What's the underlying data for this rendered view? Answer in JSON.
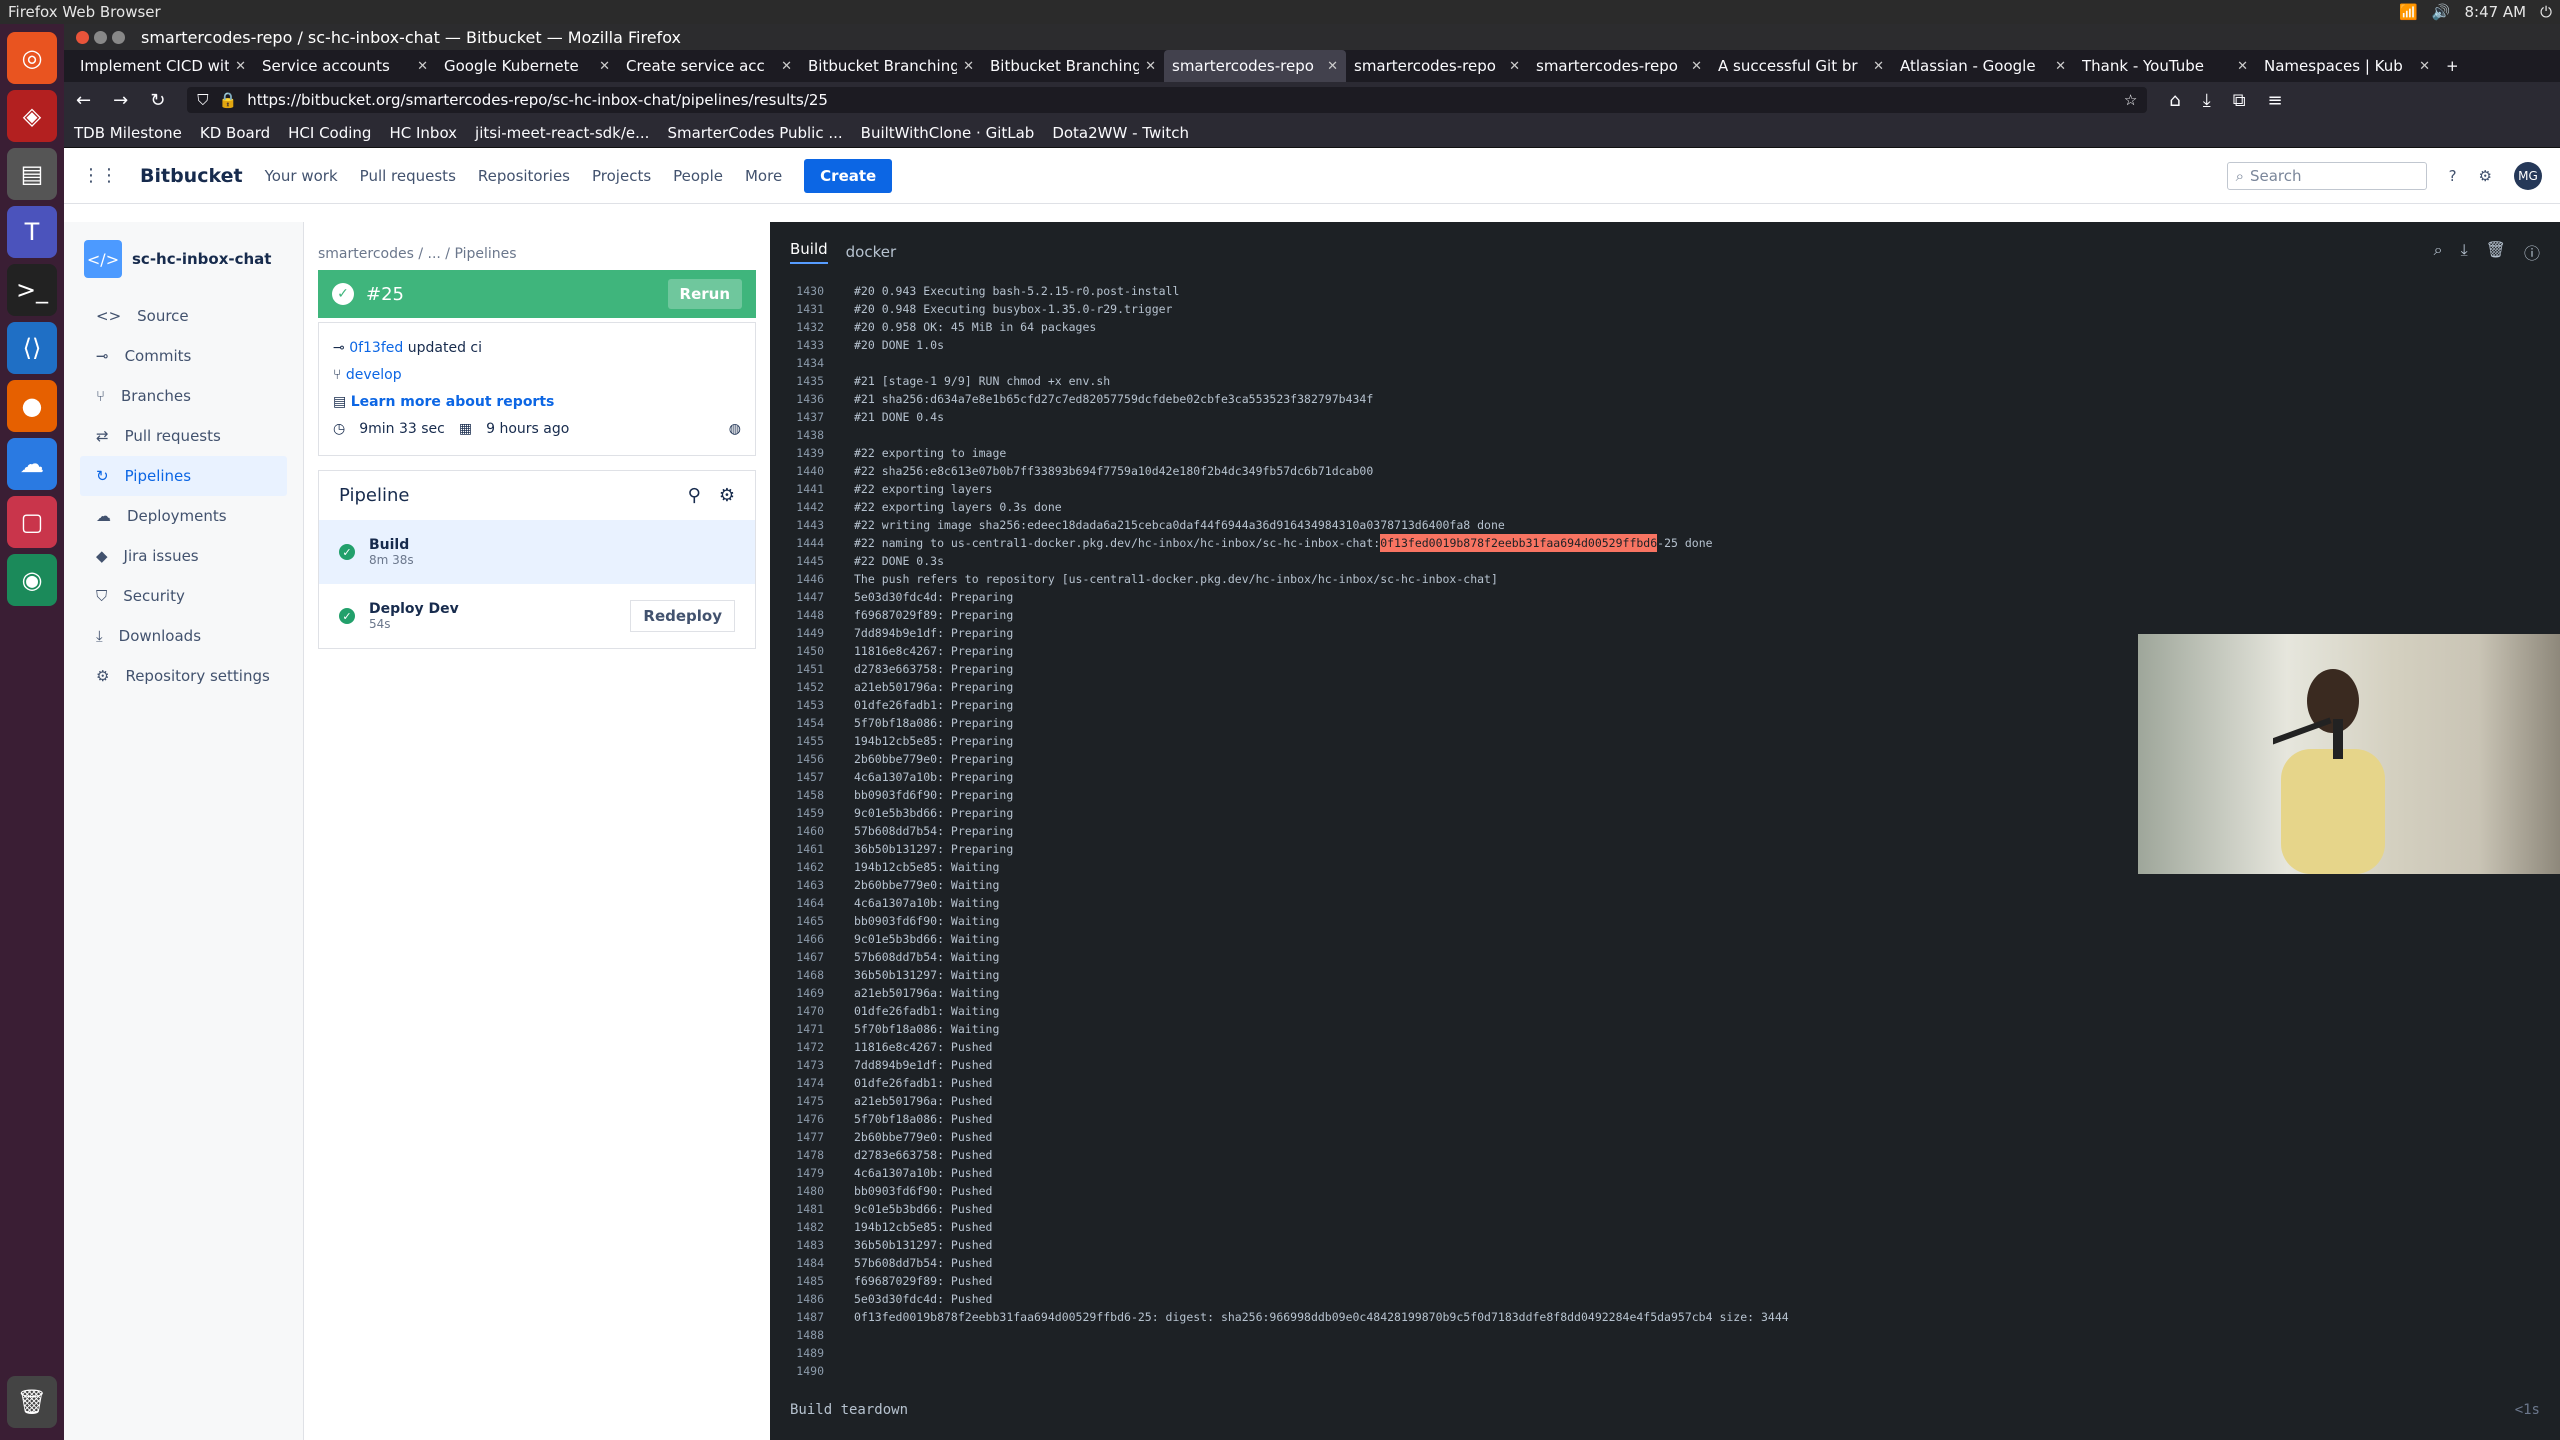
{
  "os": {
    "app_name": "Firefox Web Browser",
    "time": "8:47 AM"
  },
  "window": {
    "title": "smartercodes-repo / sc-hc-inbox-chat — Bitbucket — Mozilla Firefox"
  },
  "tabs": [
    {
      "label": "Implement CICD with"
    },
    {
      "label": "Service accounts"
    },
    {
      "label": "Google Kubernete"
    },
    {
      "label": "Create service acc"
    },
    {
      "label": "Bitbucket Branching"
    },
    {
      "label": "Bitbucket Branching"
    },
    {
      "label": "smartercodes-repo",
      "active": true
    },
    {
      "label": "smartercodes-repo"
    },
    {
      "label": "smartercodes-repo"
    },
    {
      "label": "A successful Git br"
    },
    {
      "label": "Atlassian - Google"
    },
    {
      "label": "Thank - YouTube"
    },
    {
      "label": "Namespaces | Kub"
    }
  ],
  "url": "https://bitbucket.org/smartercodes-repo/sc-hc-inbox-chat/pipelines/results/25",
  "bookmarks": [
    "TDB Milestone",
    "KD Board",
    "HCI Coding",
    "HC Inbox",
    "jitsi-meet-react-sdk/e...",
    "SmarterCodes Public ...",
    "BuiltWithClone · GitLab",
    "Dota2WW - Twitch"
  ],
  "bb": {
    "logo": "Bitbucket",
    "nav": [
      "Your work",
      "Pull requests",
      "Repositories",
      "Projects",
      "People",
      "More"
    ],
    "create": "Create",
    "search_placeholder": "Search",
    "avatar": "MG"
  },
  "sidebar": {
    "repo": "sc-hc-inbox-chat",
    "items": [
      "Source",
      "Commits",
      "Branches",
      "Pull requests",
      "Pipelines",
      "Deployments",
      "Jira issues",
      "Security",
      "Downloads",
      "Repository settings"
    ]
  },
  "pipeline": {
    "breadcrumb": "smartercodes  /  ...  /  Pipelines",
    "number": "#25",
    "rerun": "Rerun",
    "commit": "0f13fed",
    "commit_msg": "updated ci",
    "branch": "develop",
    "reports": "Learn more about reports",
    "duration": "9min 33 sec",
    "ago": "9 hours ago",
    "heading": "Pipeline",
    "steps": [
      {
        "name": "Build",
        "time": "8m 38s"
      },
      {
        "name": "Deploy Dev",
        "time": "54s",
        "action": "Redeploy"
      }
    ]
  },
  "log": {
    "tabs": [
      "Build",
      "docker"
    ],
    "lines": [
      [
        "1430",
        "#20 0.943 Executing bash-5.2.15-r0.post-install"
      ],
      [
        "1431",
        "#20 0.948 Executing busybox-1.35.0-r29.trigger"
      ],
      [
        "1432",
        "#20 0.958 OK: 45 MiB in 64 packages"
      ],
      [
        "1433",
        "#20 DONE 1.0s"
      ],
      [
        "1434",
        ""
      ],
      [
        "1435",
        "#21 [stage-1 9/9] RUN chmod +x env.sh"
      ],
      [
        "1436",
        "#21 sha256:d634a7e8e1b65cfd27c7ed82057759dcfdebe02cbfe3ca553523f382797b434f"
      ],
      [
        "1437",
        "#21 DONE 0.4s"
      ],
      [
        "1438",
        ""
      ],
      [
        "1439",
        "#22 exporting to image"
      ],
      [
        "1440",
        "#22 sha256:e8c613e07b0b7ff33893b694f7759a10d42e180f2b4dc349fb57dc6b71dcab00"
      ],
      [
        "1441",
        "#22 exporting layers"
      ],
      [
        "1442",
        "#22 exporting layers 0.3s done"
      ],
      [
        "1443",
        "#22 writing image sha256:edeec18dada6a215cebca0daf44f6944a36d916434984310a0378713d6400fa8 done"
      ],
      [
        "1444",
        "#22 naming to us-central1-docker.pkg.dev/hc-inbox/hc-inbox/sc-hc-inbox-chat:"
      ],
      [
        "1445",
        "#22 DONE 0.3s"
      ],
      [
        "1446",
        "The push refers to repository [us-central1-docker.pkg.dev/hc-inbox/hc-inbox/sc-hc-inbox-chat]"
      ],
      [
        "1447",
        "5e03d30fdc4d: Preparing"
      ],
      [
        "1448",
        "f69687029f89: Preparing"
      ],
      [
        "1449",
        "7dd894b9e1df: Preparing"
      ],
      [
        "1450",
        "11816e8c4267: Preparing"
      ],
      [
        "1451",
        "d2783e663758: Preparing"
      ],
      [
        "1452",
        "a21eb501796a: Preparing"
      ],
      [
        "1453",
        "01dfe26fadb1: Preparing"
      ],
      [
        "1454",
        "5f70bf18a086: Preparing"
      ],
      [
        "1455",
        "194b12cb5e85: Preparing"
      ],
      [
        "1456",
        "2b60bbe779e0: Preparing"
      ],
      [
        "1457",
        "4c6a1307a10b: Preparing"
      ],
      [
        "1458",
        "bb0903fd6f90: Preparing"
      ],
      [
        "1459",
        "9c01e5b3bd66: Preparing"
      ],
      [
        "1460",
        "57b608dd7b54: Preparing"
      ],
      [
        "1461",
        "36b50b131297: Preparing"
      ],
      [
        "1462",
        "194b12cb5e85: Waiting"
      ],
      [
        "1463",
        "2b60bbe779e0: Waiting"
      ],
      [
        "1464",
        "4c6a1307a10b: Waiting"
      ],
      [
        "1465",
        "bb0903fd6f90: Waiting"
      ],
      [
        "1466",
        "9c01e5b3bd66: Waiting"
      ],
      [
        "1467",
        "57b608dd7b54: Waiting"
      ],
      [
        "1468",
        "36b50b131297: Waiting"
      ],
      [
        "1469",
        "a21eb501796a: Waiting"
      ],
      [
        "1470",
        "01dfe26fadb1: Waiting"
      ],
      [
        "1471",
        "5f70bf18a086: Waiting"
      ],
      [
        "1472",
        "11816e8c4267: Pushed"
      ],
      [
        "1473",
        "7dd894b9e1df: Pushed"
      ],
      [
        "1474",
        "01dfe26fadb1: Pushed"
      ],
      [
        "1475",
        "a21eb501796a: Pushed"
      ],
      [
        "1476",
        "5f70bf18a086: Pushed"
      ],
      [
        "1477",
        "2b60bbe779e0: Pushed"
      ],
      [
        "1478",
        "d2783e663758: Pushed"
      ],
      [
        "1479",
        "4c6a1307a10b: Pushed"
      ],
      [
        "1480",
        "bb0903fd6f90: Pushed"
      ],
      [
        "1481",
        "9c01e5b3bd66: Pushed"
      ],
      [
        "1482",
        "194b12cb5e85: Pushed"
      ],
      [
        "1483",
        "36b50b131297: Pushed"
      ],
      [
        "1484",
        "57b608dd7b54: Pushed"
      ],
      [
        "1485",
        "f69687029f89: Pushed"
      ],
      [
        "1486",
        "5e03d30fdc4d: Pushed"
      ],
      [
        "1487",
        "0f13fed0019b878f2eebb31faa694d00529ffbd6-25: digest: sha256:966998ddb09e0c48428199870b9c5f0d7183ddfe8f8dd0492284e4f5da957cb4 size: 3444"
      ],
      [
        "1488",
        ""
      ],
      [
        "1489",
        ""
      ],
      [
        "1490",
        ""
      ]
    ],
    "highlight": "0f13fed0019b878f2eebb31faa694d00529ffbd6",
    "highlight_suffix": "-25 done",
    "teardown": "Build teardown",
    "teardown_time": "<1s"
  }
}
